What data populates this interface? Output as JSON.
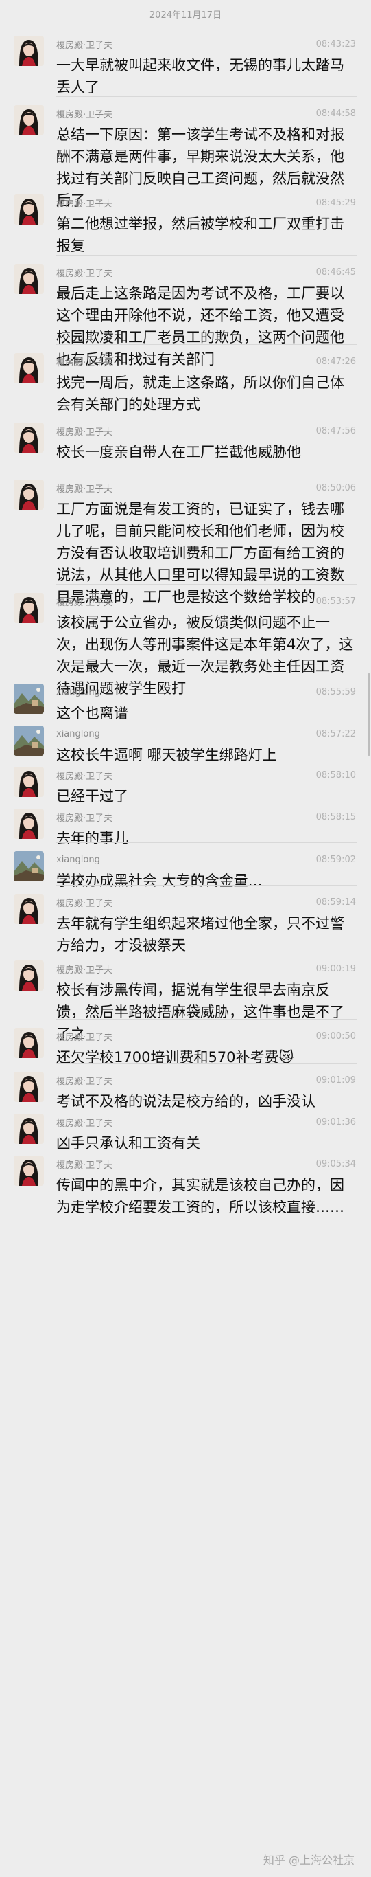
{
  "date_separator": "2024年11月17日",
  "messages": [
    {
      "sender": "榎房殿·卫子夫",
      "avatar": "portrait-avatar-woman",
      "time": "08:43:23",
      "text": "一大早就被叫起来收文件，无锡的事儿太踏马丢人了"
    },
    {
      "sender": "榎房殿·卫子夫",
      "avatar": "portrait-avatar-woman",
      "time": "08:44:58",
      "text": "总结一下原因：第一该学生考试不及格和对报酬不满意是两件事，早期来说没太大关系，他找过有关部门反映自己工资问题，然后就没然后了"
    },
    {
      "sender": "榎房殿·卫子夫",
      "avatar": "portrait-avatar-woman",
      "time": "08:45:29",
      "text": "第二他想过举报，然后被学校和工厂双重打击报复"
    },
    {
      "sender": "榎房殿·卫子夫",
      "avatar": "portrait-avatar-woman",
      "time": "08:46:45",
      "text": "最后走上这条路是因为考试不及格，工厂要以这个理由开除他不说，还不给工资，他又遭受校园欺凌和工厂老员工的欺负，这两个问题他也有反馈和找过有关部门"
    },
    {
      "sender": "榎房殿·卫子夫",
      "avatar": "portrait-avatar-woman",
      "time": "08:47:26",
      "text": "找完一周后，就走上这条路，所以你们自己体会有关部门的处理方式"
    },
    {
      "sender": "榎房殿·卫子夫",
      "avatar": "portrait-avatar-woman",
      "time": "08:47:56",
      "text": "校长一度亲自带人在工厂拦截他威胁他"
    },
    {
      "sender": "榎房殿·卫子夫",
      "avatar": "portrait-avatar-woman",
      "time": "08:50:06",
      "text": "工厂方面说是有发工资的，已证实了，钱去哪儿了呢，目前只能问校长和他们老师，因为校方没有否认收取培训费和工厂方面有给工资的说法，从其他人口里可以得知最早说的工资数目是满意的，工厂也是按这个数给学校的"
    },
    {
      "sender": "榎房殿·卫子夫",
      "avatar": "portrait-avatar-woman",
      "time": "08:53:57",
      "text": "该校属于公立省办，被反馈类似问题不止一次，出现伤人等刑事案件这是本年第4次了，这次是最大一次，最近一次是教务处主任因工资待遇问题被学生殴打"
    },
    {
      "sender": "xianglong",
      "avatar": "landscape-avatar",
      "time": "08:55:59",
      "text": "这个也离谱"
    },
    {
      "sender": "xianglong",
      "avatar": "landscape-avatar",
      "time": "08:57:22",
      "text": "这校长牛逼啊 哪天被学生绑路灯上"
    },
    {
      "sender": "榎房殿·卫子夫",
      "avatar": "portrait-avatar-woman",
      "time": "08:58:10",
      "text": "已经干过了"
    },
    {
      "sender": "榎房殿·卫子夫",
      "avatar": "portrait-avatar-woman",
      "time": "08:58:15",
      "text": "去年的事儿"
    },
    {
      "sender": "xianglong",
      "avatar": "landscape-avatar",
      "time": "08:59:02",
      "text": "学校办成黑社会 大专的含金量…"
    },
    {
      "sender": "榎房殿·卫子夫",
      "avatar": "portrait-avatar-woman",
      "time": "08:59:14",
      "text": "去年就有学生组织起来堵过他全家，只不过警方给力，才没被祭天"
    },
    {
      "sender": "榎房殿·卫子夫",
      "avatar": "portrait-avatar-woman",
      "time": "09:00:19",
      "text": "校长有涉黑传闻，据说有学生很早去南京反馈，然后半路被捂麻袋威胁，这件事也是不了了之"
    },
    {
      "sender": "榎房殿·卫子夫",
      "avatar": "portrait-avatar-woman",
      "time": "09:00:50",
      "text": "还欠学校1700培训费和570补考费😿"
    },
    {
      "sender": "榎房殿·卫子夫",
      "avatar": "portrait-avatar-woman",
      "time": "09:01:09",
      "text": "考试不及格的说法是校方给的，凶手没认"
    },
    {
      "sender": "榎房殿·卫子夫",
      "avatar": "portrait-avatar-woman",
      "time": "09:01:36",
      "text": "凶手只承认和工资有关"
    },
    {
      "sender": "榎房殿·卫子夫",
      "avatar": "portrait-avatar-woman",
      "time": "09:05:34",
      "text": "传闻中的黑中介，其实就是该校自己办的，因为走学校介绍要发工资的，所以该校直接……"
    }
  ],
  "watermark": "知乎 @上海公社京"
}
